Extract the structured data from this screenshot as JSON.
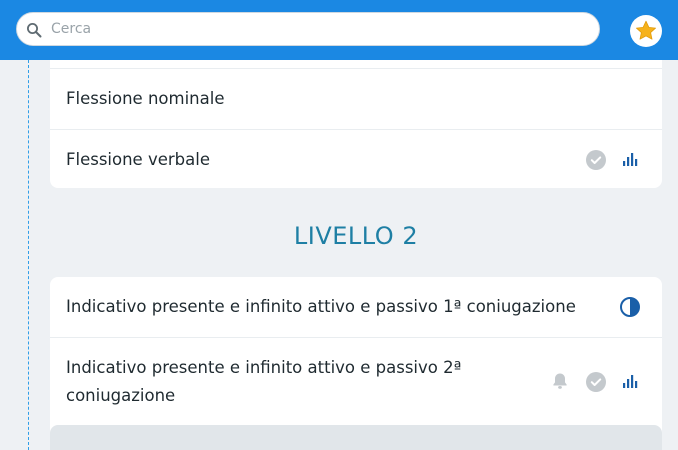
{
  "search": {
    "placeholder": "Cerca",
    "value": ""
  },
  "header": {
    "favorites_icon": "star-icon"
  },
  "levels": [
    {
      "rows": [
        {
          "label": "Flessione nominale",
          "icons": []
        },
        {
          "label": "Flessione verbale",
          "icons": [
            "check-circle-icon",
            "stats-icon"
          ]
        }
      ]
    },
    {
      "title": "LIVELLO 2",
      "rows": [
        {
          "label": "Indicativo presente e infinito attivo e passivo 1ª coniugazione",
          "icons": [
            "half-circle-icon"
          ]
        },
        {
          "label": "Indicativo presente e infinito attivo e passivo 2ª coniugazione",
          "icons": [
            "bell-icon",
            "check-circle-icon",
            "stats-icon"
          ]
        }
      ]
    }
  ],
  "colors": {
    "accent": "#1b88e3",
    "level_title": "#1e7fa4",
    "icon_blue": "#1a5fa8",
    "star": "#f6b21b",
    "icon_gray": "#c4c9cd"
  }
}
